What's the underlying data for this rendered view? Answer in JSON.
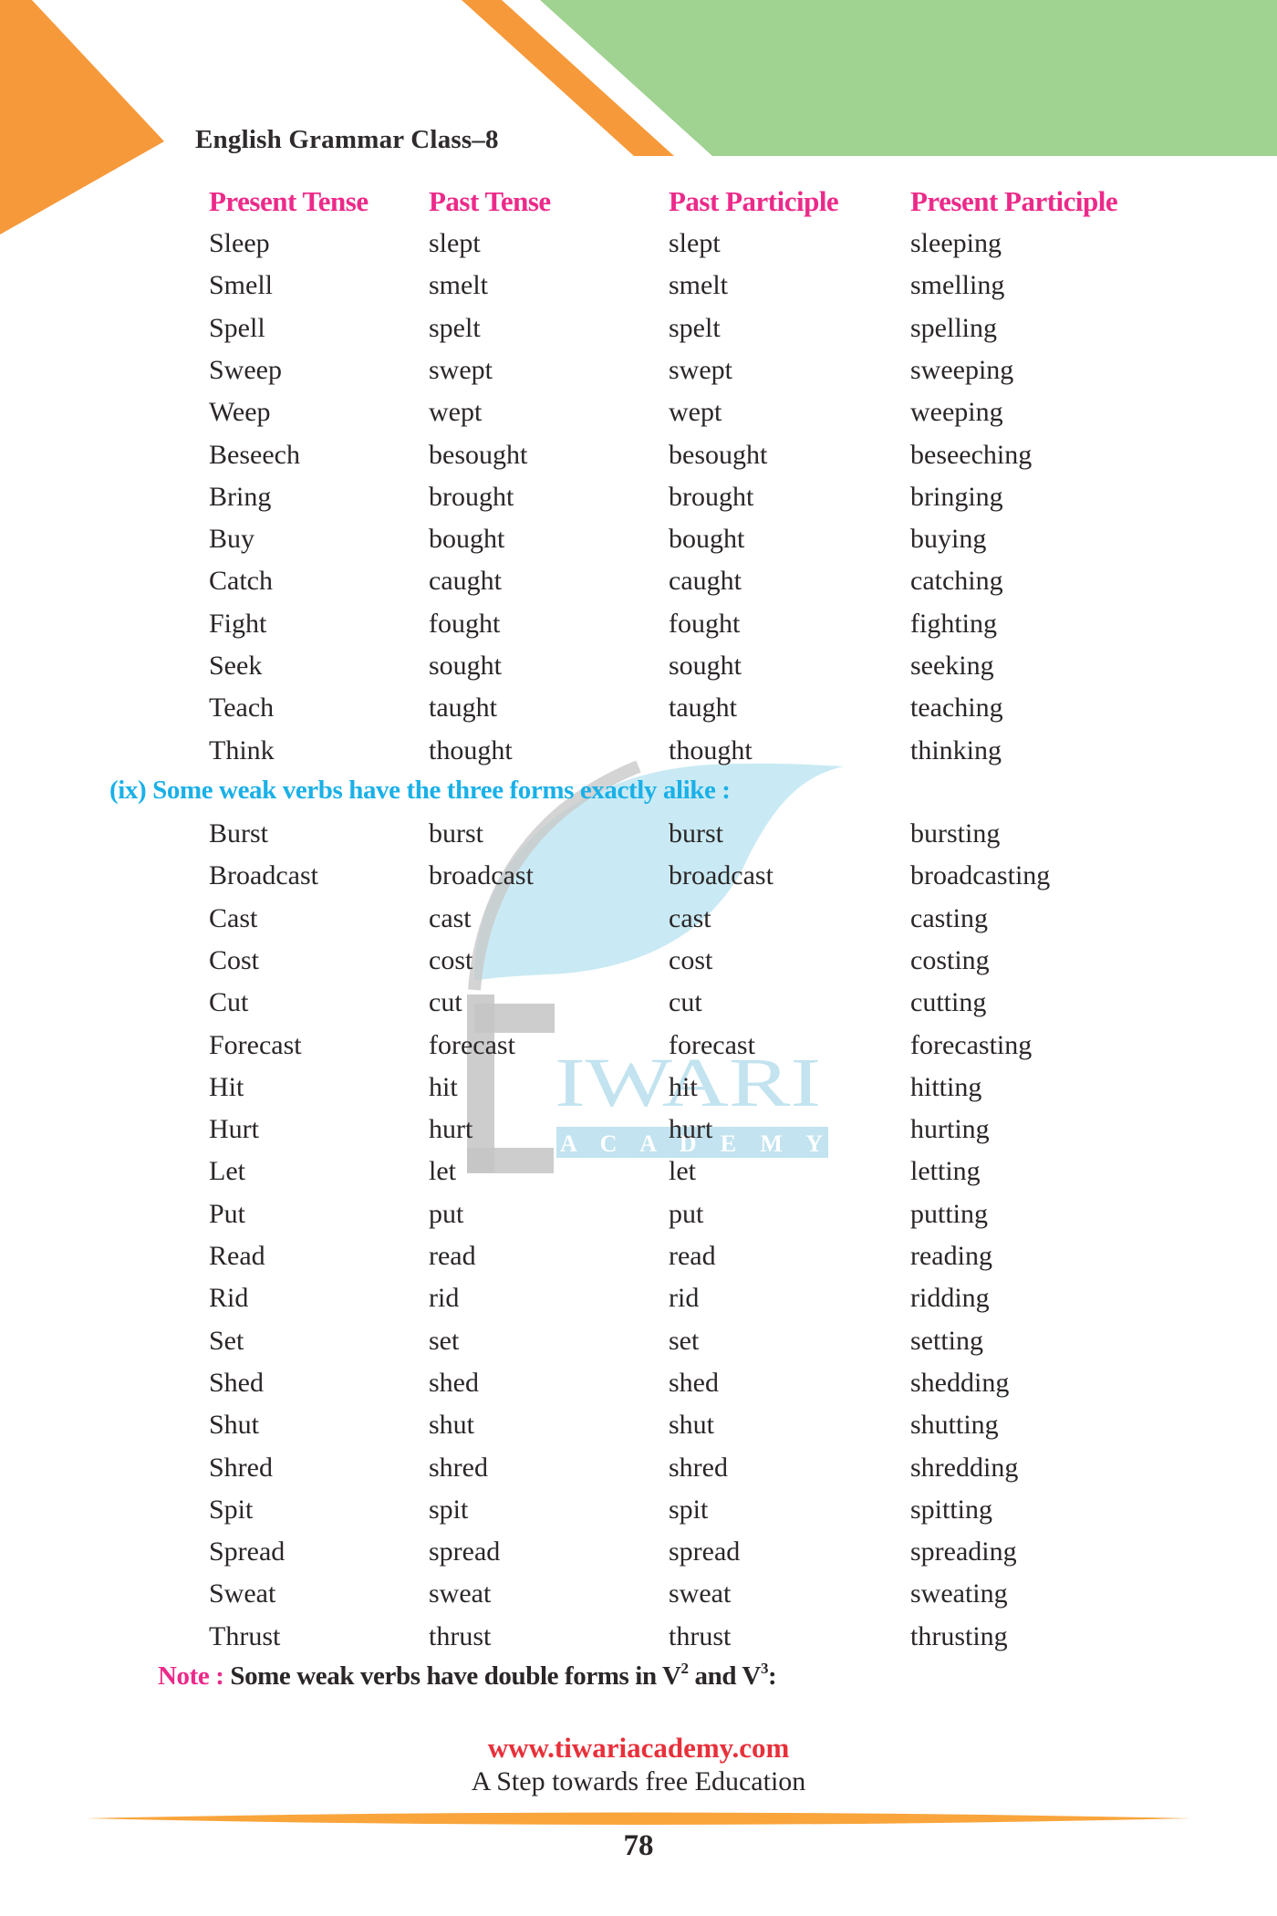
{
  "header": {
    "book_title": "English Grammar Class–8"
  },
  "table": {
    "columns": [
      "Present Tense",
      "Past Tense",
      "Past Participle",
      "Present Participle"
    ],
    "section1_rows": [
      [
        "Sleep",
        "slept",
        "slept",
        "sleeping"
      ],
      [
        "Smell",
        "smelt",
        "smelt",
        "smelling"
      ],
      [
        "Spell",
        "spelt",
        "spelt",
        "spelling"
      ],
      [
        "Sweep",
        "swept",
        "swept",
        "sweeping"
      ],
      [
        "Weep",
        "wept",
        "wept",
        "weeping"
      ],
      [
        "Beseech",
        "besought",
        "besought",
        "beseeching"
      ],
      [
        "Bring",
        "brought",
        "brought",
        "bringing"
      ],
      [
        "Buy",
        "bought",
        "bought",
        "buying"
      ],
      [
        "Catch",
        "caught",
        "caught",
        "catching"
      ],
      [
        "Fight",
        "fought",
        "fought",
        "fighting"
      ],
      [
        "Seek",
        "sought",
        "sought",
        "seeking"
      ],
      [
        "Teach",
        "taught",
        "taught",
        "teaching"
      ],
      [
        "Think",
        "thought",
        "thought",
        "thinking"
      ]
    ],
    "section2_heading": "(ix) Some weak verbs have the three forms exactly alike :",
    "section2_rows": [
      [
        "Burst",
        "burst",
        "burst",
        "bursting"
      ],
      [
        "Broadcast",
        "broadcast",
        "broadcast",
        "broadcasting"
      ],
      [
        "Cast",
        "cast",
        "cast",
        "casting"
      ],
      [
        "Cost",
        "cost",
        "cost",
        "costing"
      ],
      [
        "Cut",
        "cut",
        "cut",
        "cutting"
      ],
      [
        "Forecast",
        "forecast",
        "forecast",
        "forecasting"
      ],
      [
        "Hit",
        "hit",
        "hit",
        "hitting"
      ],
      [
        "Hurt",
        "hurt",
        "hurt",
        "hurting"
      ],
      [
        "Let",
        "let",
        "let",
        "letting"
      ],
      [
        "Put",
        "put",
        "put",
        "putting"
      ],
      [
        "Read",
        "read",
        "read",
        "reading"
      ],
      [
        "Rid",
        "rid",
        "rid",
        "ridding"
      ],
      [
        "Set",
        "set",
        "set",
        "setting"
      ],
      [
        "Shed",
        "shed",
        "shed",
        "shedding"
      ],
      [
        "Shut",
        "shut",
        "shut",
        "shutting"
      ],
      [
        "Shred",
        "shred",
        "shred",
        "shredding"
      ],
      [
        "Spit",
        "spit",
        "spit",
        "spitting"
      ],
      [
        "Spread",
        "spread",
        "spread",
        "spreading"
      ],
      [
        "Sweat",
        "sweat",
        "sweat",
        "sweating"
      ],
      [
        "Thrust",
        "thrust",
        "thrust",
        "thrusting"
      ]
    ]
  },
  "note": {
    "label": "Note :",
    "text_before_v2": "Some weak verbs have double forms in V",
    "sup2": "2",
    "text_and": " and V",
    "sup3": "3",
    "text_end": ":"
  },
  "watermark": {
    "word": "IWARI",
    "subword": "A C A D E M Y"
  },
  "footer": {
    "url": "www.tiwariacademy.com",
    "tagline": "A Step towards free Education",
    "page_number": "78"
  },
  "colors": {
    "orange": "#f6993a",
    "green": "#a0d291",
    "column_header_pink": "#ec2a8a",
    "section_heading_blue": "#1ab0e8",
    "url_red": "#e8303a"
  }
}
